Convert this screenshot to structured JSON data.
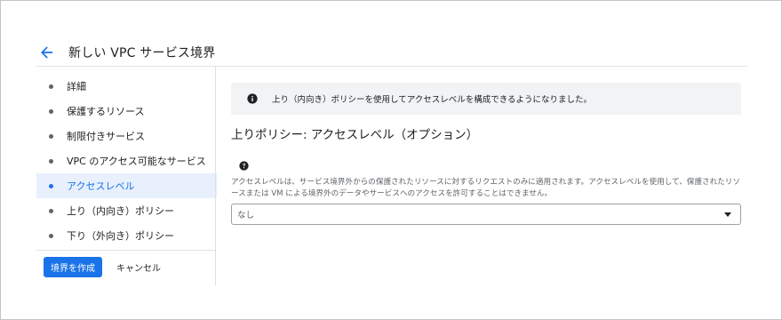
{
  "header": {
    "title": "新しい VPC サービス境界"
  },
  "sidebar": {
    "items": [
      {
        "label": "詳細",
        "active": false
      },
      {
        "label": "保護するリソース",
        "active": false
      },
      {
        "label": "制限付きサービス",
        "active": false
      },
      {
        "label": "VPC のアクセス可能なサービス",
        "active": false
      },
      {
        "label": "アクセスレベル",
        "active": true
      },
      {
        "label": "上り（内向き）ポリシー",
        "active": false
      },
      {
        "label": "下り（外向き）ポリシー",
        "active": false
      }
    ]
  },
  "actions": {
    "create_label": "境界を作成",
    "cancel_label": "キャンセル"
  },
  "banner": {
    "text": "上り（内向き）ポリシーを使用してアクセスレベルを構成できるようになりました。"
  },
  "section": {
    "title": "上りポリシー: アクセスレベル（オプション）",
    "description": "アクセスレベルは、サービス境界外からの保護されたリソースに対するリクエストのみに適用されます。アクセスレベルを使用して、保護されたリソースまたは VM による境界外のデータやサービスへのアクセスを許可することはできません。"
  },
  "access_level_select": {
    "value": "なし"
  },
  "colors": {
    "accent": "#1a73e8",
    "active_bg": "#e8f0fe",
    "banner_bg": "#f1f3f4"
  }
}
